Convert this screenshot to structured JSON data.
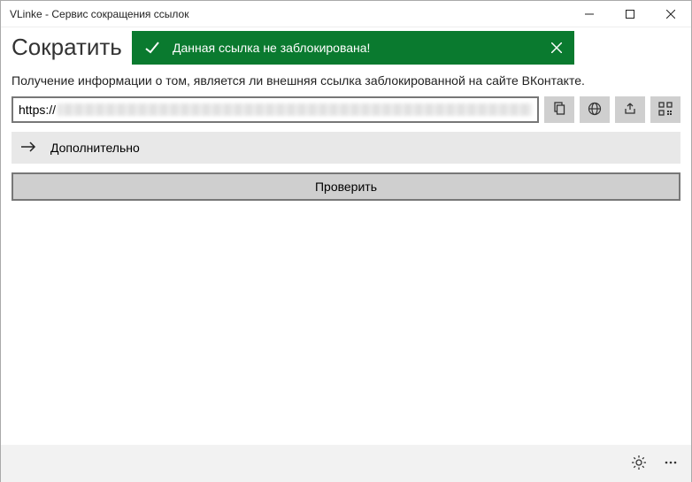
{
  "window": {
    "title": "VLinke - Сервис сокращения ссылок"
  },
  "page": {
    "heading": "Сократить",
    "description": "Получение информации о том, является ли внешняя ссылка заблокированной на сайте ВКонтакте."
  },
  "banner": {
    "message": "Данная ссылка не заблокирована!"
  },
  "url": {
    "prefix": "https://"
  },
  "expander": {
    "label": "Дополнительно"
  },
  "actions": {
    "check": "Проверить"
  }
}
